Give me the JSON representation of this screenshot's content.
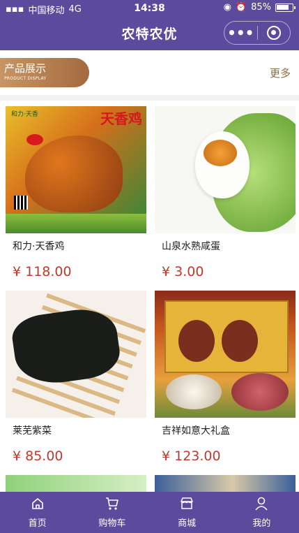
{
  "status_bar": {
    "carrier": "中国移动",
    "network": "4G",
    "time": "14:38",
    "battery": "85%"
  },
  "nav": {
    "title": "农特农优",
    "menu_icon": "more-dots-icon",
    "close_icon": "target-icon"
  },
  "section": {
    "title": "产品展示",
    "subtitle": "PRODUCT DISPLAY",
    "more": "更多"
  },
  "products": [
    {
      "name": "和力·天香鸡",
      "price": "¥ 118.00",
      "image_text": {
        "brand": "和力·天香",
        "tag": "天香鸡"
      }
    },
    {
      "name": "山泉水熟咸蛋",
      "price": "¥ 3.00"
    },
    {
      "name": "莱芜紫菜",
      "price": "¥ 85.00"
    },
    {
      "name": "吉祥如意大礼盒",
      "price": "¥ 123.00"
    }
  ],
  "tabs": [
    {
      "label": "首页",
      "icon": "home-icon"
    },
    {
      "label": "购物车",
      "icon": "cart-icon"
    },
    {
      "label": "商城",
      "icon": "store-icon"
    },
    {
      "label": "我的",
      "icon": "user-icon"
    }
  ],
  "colors": {
    "brand": "#5b4b9c",
    "price": "#c0392b",
    "pill_start": "#c89564",
    "pill_end": "#a46a3f"
  }
}
